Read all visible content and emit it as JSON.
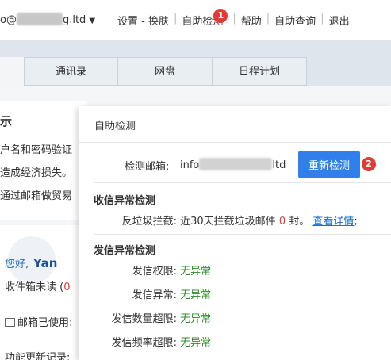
{
  "topbar": {
    "account_prefix": "o@",
    "account_suffix": "g.ltd",
    "nav": [
      {
        "label": "设置 - 换肤"
      },
      {
        "label": "自助检测",
        "badge": "1"
      },
      {
        "label": "帮助"
      },
      {
        "label": "自助查询"
      },
      {
        "label": "退出"
      }
    ]
  },
  "tabs": [
    "通讯录",
    "网盘",
    "日程计划"
  ],
  "background": {
    "title": "示",
    "lines": [
      "户名和密码验证",
      "造成经济损失。",
      "通过邮箱做贸易"
    ],
    "hello": "您好,",
    "username": "Yan",
    "unread": "收件箱未读",
    "unread_paren": "(",
    "unread_count": "0",
    "usage": "邮箱已使用:",
    "updates": "功能更新记录:"
  },
  "dialog": {
    "title": "自助检测",
    "email_label": "检测邮箱:",
    "email_prefix": "info",
    "email_suffix": "ltd",
    "recheck_label": "重新检测",
    "recheck_badge": "2",
    "incoming": {
      "title": "收信异常检测",
      "spam_label": "反垃圾拦截:",
      "spam_text1": "近30天拦截垃圾邮件",
      "spam_count": "0",
      "spam_text2": "封。",
      "spam_link": "查看详情",
      "spam_end": ";"
    },
    "outgoing": {
      "title": "发信异常检测",
      "items": [
        {
          "label": "发信权限:",
          "value": "无异常"
        },
        {
          "label": "发信异常:",
          "value": "无异常"
        },
        {
          "label": "发信数量超限:",
          "value": "无异常"
        },
        {
          "label": "发信频率超限:",
          "value": "无异常"
        }
      ]
    }
  },
  "colors": {
    "accent": "#2f80ed",
    "ok": "#2e8b2e",
    "badge": "#e53935",
    "link": "#1e6fc8"
  }
}
